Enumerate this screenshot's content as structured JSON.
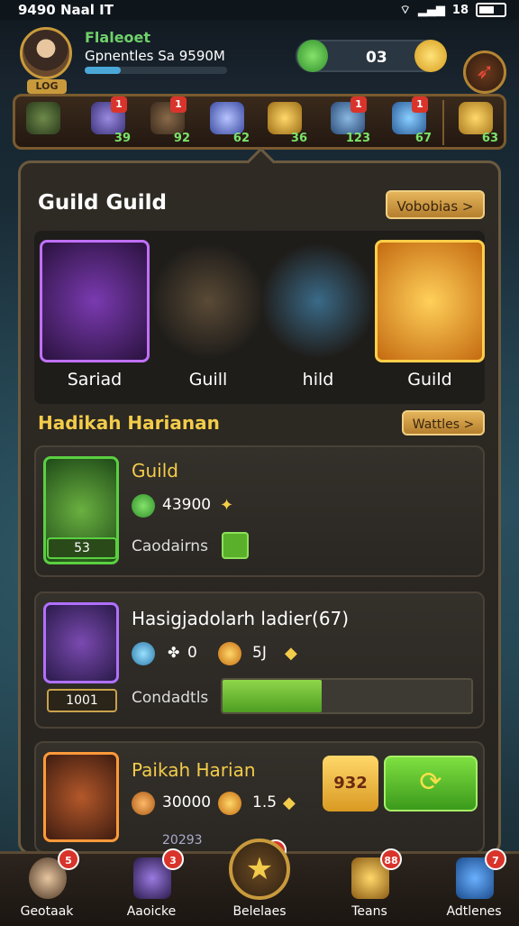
{
  "status_bar": {
    "time": "9490 Naal IT",
    "right_text": "18"
  },
  "player": {
    "name": "Flaleoet",
    "subtitle": "Gpnentles Sa 9590M",
    "level": "LOG",
    "xp_progress": 0.25
  },
  "currency": {
    "value": "03"
  },
  "item_strip": [
    {
      "count": "",
      "badge": ""
    },
    {
      "count": "39",
      "badge": "1"
    },
    {
      "count": "92",
      "badge": "1"
    },
    {
      "count": "62",
      "badge": ""
    },
    {
      "count": "36",
      "badge": ""
    },
    {
      "count": "123",
      "badge": "1"
    },
    {
      "count": "67",
      "badge": "1"
    },
    {
      "count": "63",
      "badge": ""
    }
  ],
  "guild_section": {
    "title": "Guild  Guild",
    "button": "Vobobias  >",
    "heroes": [
      {
        "name": "Sariad"
      },
      {
        "name": "Guill"
      },
      {
        "name": "hild"
      },
      {
        "name": "Guild"
      }
    ]
  },
  "daily_section": {
    "title": "Hadikah Harianan",
    "button": "Wattles  >",
    "cards": [
      {
        "title": "Guild",
        "value": "43900",
        "label": "Caodairns",
        "tag": "53"
      },
      {
        "title": "Hasigjadolarh ladier(67)",
        "v1": "0",
        "v2": "5J",
        "label": "Condadtls",
        "tag": "1001",
        "progress": 0.4
      },
      {
        "title": "Paikah Harian",
        "v1": "30000",
        "v2": "1.5",
        "sub": "20293",
        "gold_button": "932"
      }
    ]
  },
  "bottom_nav": [
    {
      "label": "Geotaak",
      "badge": "5"
    },
    {
      "label": "Aaoicke",
      "badge": "3"
    },
    {
      "label": "Belelaes",
      "badge": "8"
    },
    {
      "label": "Teans",
      "badge": "88"
    },
    {
      "label": "Adtlenes",
      "badge": "7"
    }
  ]
}
